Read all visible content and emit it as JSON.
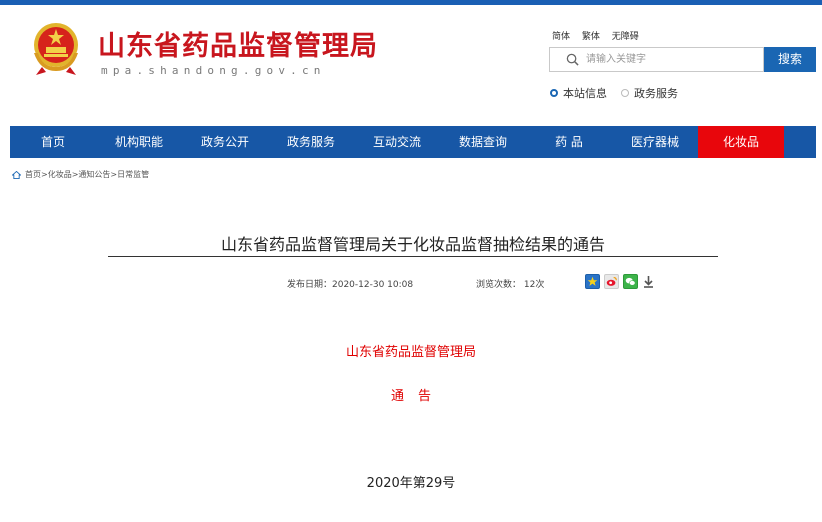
{
  "header": {
    "site_title": "山东省药品监督管理局",
    "site_domain": "mpa.shandong.gov.cn",
    "lang_links": [
      "简体",
      "繁体",
      "无障碍"
    ]
  },
  "search": {
    "placeholder": "请输入关键字",
    "button_label": "搜索",
    "scope_options": [
      {
        "label": "本站信息",
        "selected": true
      },
      {
        "label": "政务服务",
        "selected": false
      }
    ]
  },
  "nav": {
    "items": [
      {
        "label": "首页"
      },
      {
        "label": "机构职能"
      },
      {
        "label": "政务公开"
      },
      {
        "label": "政务服务"
      },
      {
        "label": "互动交流"
      },
      {
        "label": "数据查询"
      },
      {
        "label": "药 品"
      },
      {
        "label": "医疗器械"
      },
      {
        "label": "化妆品",
        "active": true
      }
    ]
  },
  "breadcrumb": {
    "text": "首页>化妆品>通知公告>日常监管"
  },
  "article": {
    "title": "山东省药品监督管理局关于化妆品监督抽检结果的通告",
    "publish_date": "发布日期：2020-12-30 10:08",
    "views": "浏览次数： 12次",
    "issuer": "山东省药品监督管理局",
    "notice_heading": "通告",
    "doc_number": "2020年第29号"
  },
  "colors": {
    "brand_red": "#c8161e",
    "nav_blue": "#1757a6",
    "active_red": "#e8060c",
    "button_blue": "#1a66b3"
  },
  "icons": [
    "national-emblem-icon",
    "search-icon",
    "home-icon",
    "qzone-share-icon",
    "weibo-share-icon",
    "wechat-share-icon",
    "download-icon"
  ]
}
